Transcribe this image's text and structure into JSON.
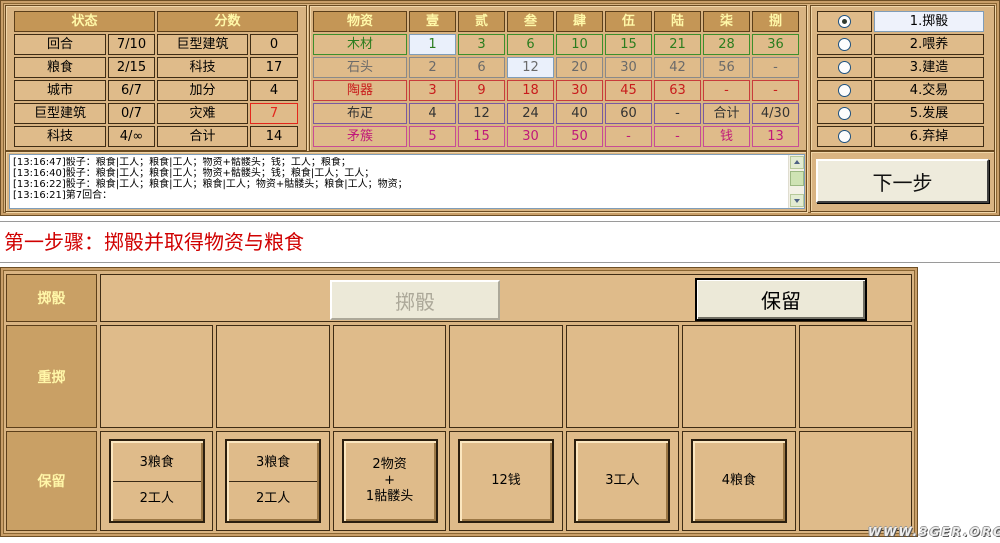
{
  "status_table": {
    "header_status": "状态",
    "header_score": "分数",
    "alert_color": "#e3261c",
    "rows": [
      {
        "label": "回合",
        "value": "7/10",
        "score_label": "巨型建筑",
        "score": "0"
      },
      {
        "label": "粮食",
        "value": "2/15",
        "score_label": "科技",
        "score": "17"
      },
      {
        "label": "城市",
        "value": "6/7",
        "score_label": "加分",
        "score": "4"
      },
      {
        "label": "巨型建筑",
        "value": "0/7",
        "score_label": "灾难",
        "score": "7"
      },
      {
        "label": "科技",
        "value": "4/∞",
        "score_label": "合计",
        "score": "14"
      }
    ]
  },
  "goods_table": {
    "headers": [
      "物资",
      "壹",
      "贰",
      "叁",
      "肆",
      "伍",
      "陆",
      "柒",
      "捌"
    ],
    "rows": [
      {
        "name": "木材",
        "color": "#2b7d1e",
        "border_color": "#3d8f2c",
        "level": 1,
        "values": [
          "1",
          "3",
          "6",
          "10",
          "15",
          "21",
          "28",
          "36"
        ]
      },
      {
        "name": "石头",
        "color": "#6a6a6a",
        "border_color": "#8a8a8a",
        "level": 3,
        "values": [
          "2",
          "6",
          "12",
          "20",
          "30",
          "42",
          "56",
          "-"
        ]
      },
      {
        "name": "陶器",
        "color": "#c81c1c",
        "border_color": "#c83c3c",
        "level": 0,
        "values": [
          "3",
          "9",
          "18",
          "30",
          "45",
          "63",
          "-",
          "-"
        ]
      },
      {
        "name": "布疋",
        "color": "#333333",
        "border_color": "#7a5aa0",
        "level": 0,
        "values": [
          "4",
          "12",
          "24",
          "40",
          "60",
          "-"
        ]
      },
      {
        "name": "矛簇",
        "color": "#c0187a",
        "border_color": "#c84c96",
        "level": 0,
        "values": [
          "5",
          "15",
          "30",
          "50",
          "-",
          "-"
        ]
      }
    ],
    "summary": {
      "goods_total_label": "合计",
      "goods_total": "4/30",
      "money_label": "钱",
      "money": "13"
    }
  },
  "phases": {
    "selected": 0,
    "items": [
      "1.掷骰",
      "2.喂养",
      "3.建造",
      "4.交易",
      "5.发展",
      "6.弃掉"
    ]
  },
  "log": {
    "lines": [
      "[13:16:47]骰子：粮食|工人；粮食|工人；物资+骷髅头；钱；工人；粮食；",
      "[13:16:40]骰子：粮食|工人；粮食|工人；物资+骷髅头；钱；粮食|工人；工人；",
      "[13:16:22]骰子：粮食|工人；粮食|工人；粮食|工人；物资+骷髅头；粮食|工人；物资；",
      "[13:16:21]第7回合："
    ]
  },
  "next_button": "下一步",
  "step_title": "第一步骤：掷骰并取得物资与粮食",
  "dice_panel": {
    "row_labels": {
      "roll": "掷骰",
      "reroll": "重掷",
      "keep": "保留"
    },
    "roll_button": "掷骰",
    "roll_button_disabled": true,
    "keep_button": "保留",
    "kept_dice": [
      {
        "top": "3粮食",
        "bottom": "2工人"
      },
      {
        "top": "3粮食",
        "bottom": "2工人"
      },
      {
        "lines": [
          "2物资",
          "+",
          "1骷髅头"
        ]
      },
      {
        "lines": [
          "12钱"
        ]
      },
      {
        "lines": [
          "3工人"
        ]
      },
      {
        "lines": [
          "4粮食"
        ]
      }
    ]
  },
  "watermark": "WWW.3GER.ORG"
}
